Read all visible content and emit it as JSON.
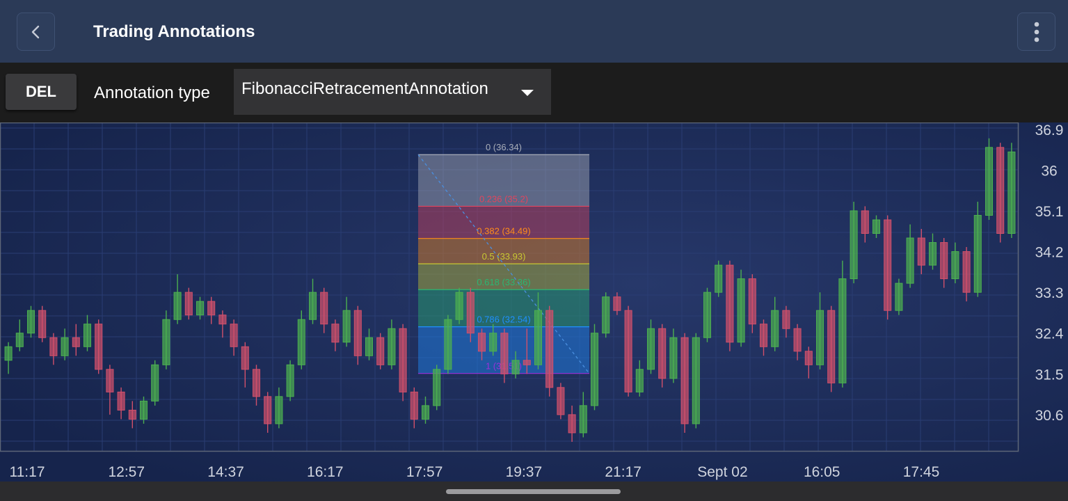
{
  "app_bar": {
    "title": "Trading Annotations",
    "back_icon": "chevron-left-icon",
    "menu_icon": "more-vertical-icon"
  },
  "toolbar": {
    "delete_label": "DEL",
    "annotation_type_label": "Annotation type",
    "annotation_type_value": "FibonacciRetracementAnnotation",
    "dropdown_icon": "caret-down-icon"
  },
  "chart_data": {
    "type": "candlestick",
    "x_tick_labels": [
      "11:17",
      "12:57",
      "14:37",
      "16:17",
      "17:57",
      "19:37",
      "21:17",
      "Sept 02",
      "16:05",
      "17:45"
    ],
    "y_tick_labels": [
      "36.9",
      "36",
      "35.1",
      "34.2",
      "33.3",
      "32.4",
      "31.5",
      "30.6"
    ],
    "ylim": [
      29.8,
      37.05
    ],
    "grid": true,
    "colors": {
      "background": "#1b2b56",
      "up_candle": "#4caf50",
      "down_candle": "#d0506b",
      "axis_text": "#d0d4de"
    },
    "fibonacci": {
      "start_price": 36.34,
      "end_price": 31.51,
      "levels": [
        {
          "ratio": 0,
          "price": 36.34,
          "label": "0 (36.34)",
          "color": "#a8adb8"
        },
        {
          "ratio": 0.236,
          "price": 35.2,
          "label": "0.236 (35.2)",
          "color": "#e0455e"
        },
        {
          "ratio": 0.382,
          "price": 34.49,
          "label": "0.382 (34.49)",
          "color": "#ff8c1a"
        },
        {
          "ratio": 0.5,
          "price": 33.93,
          "label": "0.5 (33.93)",
          "color": "#c8c832"
        },
        {
          "ratio": 0.618,
          "price": 33.36,
          "label": "0.618 (33.36)",
          "color": "#2bb673"
        },
        {
          "ratio": 0.786,
          "price": 32.54,
          "label": "0.786 (32.54)",
          "color": "#1e90ff"
        },
        {
          "ratio": 1,
          "price": 31.51,
          "label": "1 (31.51)",
          "color": "#9b30d9"
        }
      ]
    },
    "candles": [
      [
        31.8,
        32.1,
        31.5,
        32.2
      ],
      [
        32.1,
        32.4,
        32.0,
        32.7
      ],
      [
        32.4,
        32.9,
        32.3,
        33.0
      ],
      [
        32.9,
        32.3,
        32.2,
        33.0
      ],
      [
        32.3,
        31.9,
        31.7,
        32.4
      ],
      [
        31.9,
        32.3,
        31.8,
        32.5
      ],
      [
        32.3,
        32.1,
        31.9,
        32.6
      ],
      [
        32.1,
        32.6,
        32.0,
        32.8
      ],
      [
        32.6,
        31.6,
        31.5,
        32.7
      ],
      [
        31.6,
        31.1,
        30.6,
        31.7
      ],
      [
        31.1,
        30.7,
        30.5,
        31.2
      ],
      [
        30.7,
        30.5,
        30.3,
        30.9
      ],
      [
        30.5,
        30.9,
        30.4,
        31.0
      ],
      [
        30.9,
        31.7,
        30.8,
        31.8
      ],
      [
        31.7,
        32.7,
        31.6,
        32.9
      ],
      [
        32.7,
        33.3,
        32.6,
        33.7
      ],
      [
        33.3,
        32.8,
        32.7,
        33.4
      ],
      [
        32.8,
        33.1,
        32.7,
        33.2
      ],
      [
        33.1,
        32.8,
        32.6,
        33.2
      ],
      [
        32.8,
        32.6,
        32.3,
        32.9
      ],
      [
        32.6,
        32.1,
        31.9,
        32.7
      ],
      [
        32.1,
        31.6,
        31.2,
        32.2
      ],
      [
        31.6,
        31.0,
        30.8,
        31.7
      ],
      [
        31.0,
        30.4,
        30.2,
        31.1
      ],
      [
        30.4,
        31.0,
        30.3,
        31.2
      ],
      [
        31.0,
        31.7,
        30.9,
        31.8
      ],
      [
        31.7,
        32.7,
        31.6,
        32.9
      ],
      [
        32.7,
        33.3,
        32.6,
        33.6
      ],
      [
        33.3,
        32.6,
        32.4,
        33.4
      ],
      [
        32.6,
        32.2,
        32.0,
        32.7
      ],
      [
        32.2,
        32.9,
        32.1,
        33.2
      ],
      [
        32.9,
        31.9,
        31.7,
        33.0
      ],
      [
        31.9,
        32.3,
        31.8,
        32.5
      ],
      [
        32.3,
        31.7,
        31.6,
        32.4
      ],
      [
        31.7,
        32.5,
        31.6,
        32.7
      ],
      [
        32.5,
        31.1,
        30.9,
        32.6
      ],
      [
        31.1,
        30.5,
        30.3,
        31.2
      ],
      [
        30.5,
        30.8,
        30.4,
        31.0
      ],
      [
        30.8,
        31.6,
        30.7,
        31.7
      ],
      [
        31.6,
        32.7,
        31.5,
        32.8
      ],
      [
        32.7,
        33.3,
        32.6,
        33.4
      ],
      [
        33.3,
        32.4,
        32.2,
        33.4
      ],
      [
        32.4,
        32.0,
        31.8,
        32.5
      ],
      [
        32.0,
        32.4,
        31.9,
        32.6
      ],
      [
        32.4,
        31.5,
        31.3,
        32.5
      ],
      [
        31.5,
        31.8,
        31.4,
        32.0
      ],
      [
        31.8,
        31.7,
        31.5,
        32.5
      ],
      [
        31.7,
        32.9,
        31.6,
        33.3
      ],
      [
        32.9,
        31.2,
        31.0,
        33.0
      ],
      [
        31.2,
        30.6,
        30.5,
        31.3
      ],
      [
        30.6,
        30.2,
        30.0,
        30.8
      ],
      [
        30.2,
        30.8,
        30.1,
        31.1
      ],
      [
        30.8,
        32.4,
        30.7,
        32.6
      ],
      [
        32.4,
        33.2,
        32.3,
        33.3
      ],
      [
        33.2,
        32.9,
        32.8,
        33.3
      ],
      [
        32.9,
        31.1,
        31.0,
        33.0
      ],
      [
        31.1,
        31.6,
        31.0,
        31.8
      ],
      [
        31.6,
        32.5,
        31.5,
        32.7
      ],
      [
        32.5,
        31.4,
        31.2,
        32.6
      ],
      [
        31.4,
        32.3,
        31.3,
        32.5
      ],
      [
        32.3,
        30.4,
        30.2,
        32.4
      ],
      [
        30.4,
        32.3,
        30.3,
        32.4
      ],
      [
        32.3,
        33.3,
        32.2,
        33.4
      ],
      [
        33.3,
        33.9,
        33.2,
        34.0
      ],
      [
        33.9,
        32.2,
        32.0,
        34.0
      ],
      [
        32.2,
        33.6,
        32.1,
        33.8
      ],
      [
        33.6,
        32.6,
        32.4,
        33.7
      ],
      [
        32.6,
        32.1,
        31.9,
        32.7
      ],
      [
        32.1,
        32.9,
        32.0,
        33.2
      ],
      [
        32.9,
        32.5,
        32.3,
        33.0
      ],
      [
        32.5,
        32.0,
        31.8,
        32.6
      ],
      [
        32.0,
        31.7,
        31.4,
        32.1
      ],
      [
        31.7,
        32.9,
        31.6,
        33.3
      ],
      [
        32.9,
        31.3,
        31.1,
        33.0
      ],
      [
        31.3,
        33.6,
        31.2,
        34.0
      ],
      [
        33.6,
        35.1,
        33.5,
        35.3
      ],
      [
        35.1,
        34.6,
        34.4,
        35.2
      ],
      [
        34.6,
        34.9,
        34.5,
        35.0
      ],
      [
        34.9,
        32.9,
        32.7,
        35.0
      ],
      [
        32.9,
        33.5,
        32.8,
        33.6
      ],
      [
        33.5,
        34.5,
        33.4,
        34.8
      ],
      [
        34.5,
        33.9,
        33.7,
        34.7
      ],
      [
        33.9,
        34.4,
        33.8,
        34.6
      ],
      [
        34.4,
        33.6,
        33.4,
        34.5
      ],
      [
        33.6,
        34.2,
        33.5,
        34.4
      ],
      [
        34.2,
        33.3,
        33.1,
        34.3
      ],
      [
        33.3,
        35.0,
        33.2,
        35.3
      ],
      [
        35.0,
        36.5,
        34.9,
        36.7
      ],
      [
        36.5,
        34.6,
        34.4,
        36.6
      ],
      [
        34.6,
        36.4,
        34.5,
        36.6
      ]
    ]
  }
}
